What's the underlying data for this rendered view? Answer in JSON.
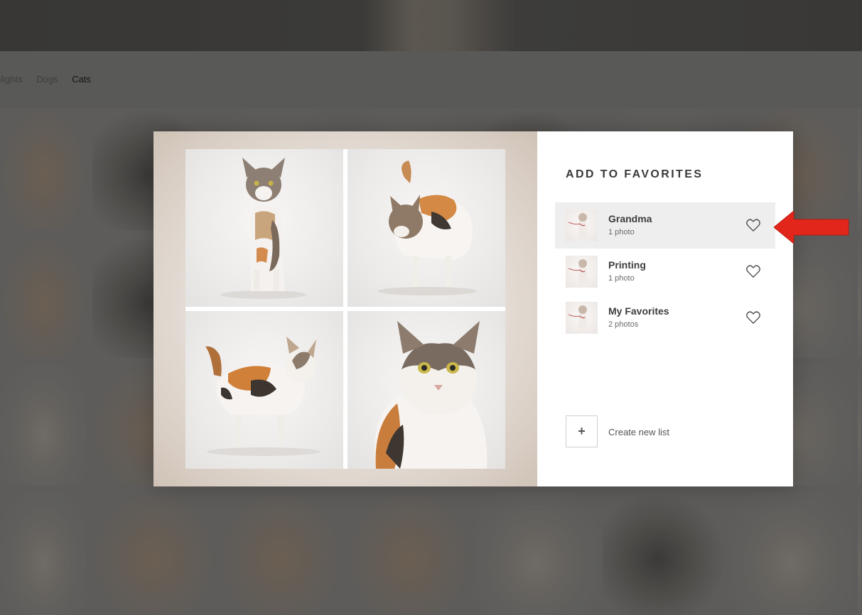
{
  "nav": {
    "items": [
      "nlights",
      "Dogs",
      "Cats"
    ],
    "active": "Cats"
  },
  "modal": {
    "title": "ADD TO FAVORITES",
    "lists": [
      {
        "name": "Grandma",
        "count": "1 photo"
      },
      {
        "name": "Printing",
        "count": "1 photo"
      },
      {
        "name": "My Favorites",
        "count": "2 photos"
      }
    ],
    "create_label": "Create new list",
    "create_icon": "plus-icon",
    "favorite_icon": "heart-outline-icon"
  },
  "colors": {
    "annotation_arrow": "#e3261b",
    "hover_row": "#eeeeee"
  }
}
